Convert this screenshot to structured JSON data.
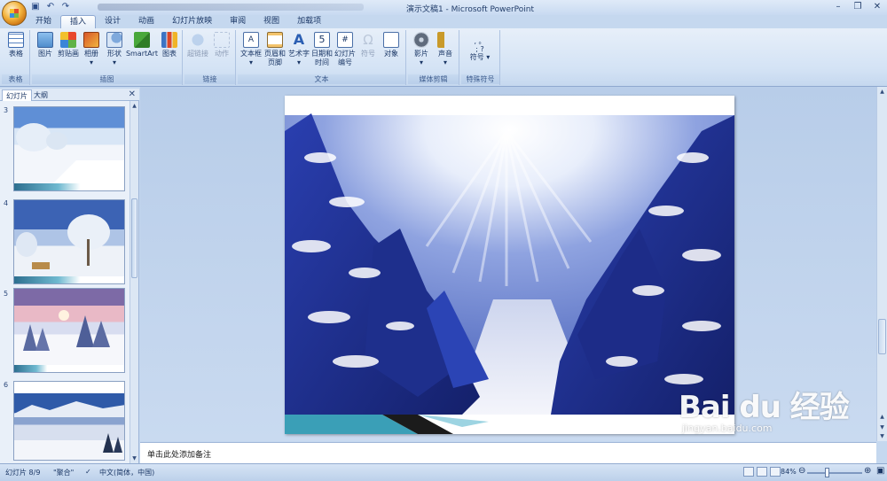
{
  "window": {
    "title": "演示文稿1 - Microsoft PowerPoint",
    "controls": [
      "–",
      "❐",
      "✕"
    ]
  },
  "quick_access": [
    "save-icon",
    "undo-icon",
    "redo-icon"
  ],
  "tabs": [
    {
      "label": "开始"
    },
    {
      "label": "插入",
      "active": true
    },
    {
      "label": "设计"
    },
    {
      "label": "动画"
    },
    {
      "label": "幻灯片放映"
    },
    {
      "label": "审阅"
    },
    {
      "label": "视图"
    },
    {
      "label": "加载项"
    }
  ],
  "ribbon": {
    "groups": [
      {
        "label": "表格",
        "buttons": [
          {
            "label": "表格",
            "icon": "table-icon"
          }
        ]
      },
      {
        "label": "插图",
        "buttons": [
          {
            "label": "图片",
            "icon": "picture-icon"
          },
          {
            "label": "剪贴画",
            "icon": "clipart-icon"
          },
          {
            "label": "相册",
            "icon": "album-icon"
          },
          {
            "label": "形状",
            "icon": "shapes-icon"
          },
          {
            "label": "SmartArt",
            "icon": "smartart-icon"
          },
          {
            "label": "图表",
            "icon": "chart-icon"
          }
        ]
      },
      {
        "label": "链接",
        "buttons": [
          {
            "label": "超链接",
            "icon": "hyperlink-icon",
            "disabled": true
          },
          {
            "label": "动作",
            "icon": "action-icon",
            "disabled": true
          }
        ]
      },
      {
        "label": "文本",
        "buttons": [
          {
            "label": "文本框",
            "icon": "textbox-icon"
          },
          {
            "label": "页眉和页脚",
            "icon": "header-footer-icon"
          },
          {
            "label": "艺术字",
            "icon": "wordart-icon"
          },
          {
            "label": "日期和时间",
            "icon": "datetime-icon"
          },
          {
            "label": "幻灯片编号",
            "icon": "slide-number-icon"
          },
          {
            "label": "符号",
            "icon": "symbol-icon",
            "disabled": true
          },
          {
            "label": "对象",
            "icon": "object-icon"
          }
        ]
      },
      {
        "label": "媒体剪辑",
        "buttons": [
          {
            "label": "影片",
            "icon": "movie-icon"
          },
          {
            "label": "声音",
            "icon": "sound-icon"
          }
        ]
      },
      {
        "label": "特殊符号",
        "buttons": [
          {
            "label": "符号",
            "icon": "special-symbol-icon"
          }
        ]
      }
    ]
  },
  "slide_panel": {
    "tabs": [
      "幻灯片",
      "大纲"
    ],
    "close": "✕",
    "thumbnails": [
      {
        "number": "3"
      },
      {
        "number": "4"
      },
      {
        "number": "5"
      },
      {
        "number": "6"
      }
    ]
  },
  "notes": {
    "placeholder": "单击此处添加备注"
  },
  "status": {
    "slide": "幻灯片 8/9",
    "theme": "\"聚合\"",
    "language": "中文(简体，中国)",
    "zoom": "84%"
  },
  "watermark": {
    "logo": "Bai du 经验",
    "url": "jingyan.baidu.com"
  }
}
